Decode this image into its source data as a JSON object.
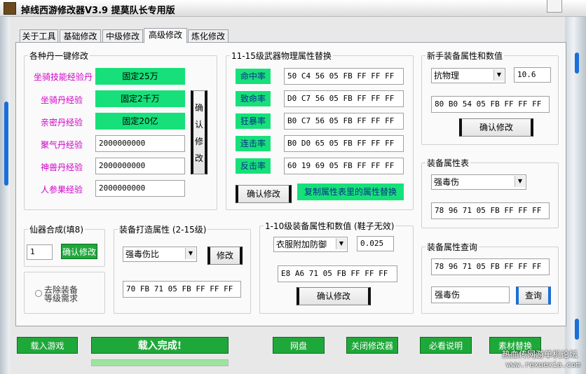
{
  "window": {
    "title": "掉线西游修改器V3.9  提莫队长专用版"
  },
  "tabs": [
    "关于工具",
    "基础修改",
    "中级修改",
    "高级修改",
    "炼化修改"
  ],
  "dan": {
    "title": "各种丹一键修改",
    "rows": [
      {
        "label": "坐骑技能经验丹",
        "value": "固定25万"
      },
      {
        "label": "坐骑丹经验",
        "value": "固定2千万"
      },
      {
        "label": "亲密丹经验",
        "value": "固定20亿"
      },
      {
        "label": "聚气丹经验",
        "value": "2000000000"
      },
      {
        "label": "神兽丹经验",
        "value": "2000000000"
      },
      {
        "label": "人参果经验",
        "value": "2000000000"
      }
    ],
    "confirm": [
      "确",
      "认",
      "修",
      "改"
    ]
  },
  "weapon": {
    "title": "11-15级武器物理属性替换",
    "rows": [
      {
        "label": "命中率",
        "value": "50 C4 56 05 FB FF FF FF"
      },
      {
        "label": "致命率",
        "value": "D0 C7 56 05 FB FF FF FF"
      },
      {
        "label": "狂暴率",
        "value": "B0 C7 56 05 FB FF FF FF"
      },
      {
        "label": "连击率",
        "value": "B0 D0 65 05 FB FF FF FF"
      },
      {
        "label": "反击率",
        "value": "60 19 69 05 FB FF FF FF"
      }
    ],
    "confirm": "确认修改",
    "copy": "复制属性表里的属性替换"
  },
  "newbie": {
    "title": "新手装备属性和数值",
    "attr": "抗物理",
    "num": "10.6",
    "code": "80 B0 54 05 FB FF FF FF",
    "confirm": "确认修改"
  },
  "attrtable": {
    "title": "装备属性表",
    "attr": "强毒伤",
    "code": "78 96 71 05 FB FF FF FF"
  },
  "query": {
    "title": "装备属性查询",
    "code": "78 96 71 05 FB FF FF FF",
    "name": "强毒伤",
    "btn": "查询"
  },
  "synth": {
    "title": "仙器合成(填8)",
    "value": "1",
    "btn": "确认修改",
    "radio": "去除装备等级需求"
  },
  "forge": {
    "title": "装备打造属性 (2-15级)",
    "attr": "强毒伤比",
    "btn": "修改",
    "code": "70 FB 71 05 FB FF FF FF"
  },
  "lvl110": {
    "title": "1-10级装备属性和数值 (鞋子无效)",
    "attr": "衣服附加防御",
    "num": "0.025",
    "code": "E8 A6 71 05 FB FF FF FF",
    "confirm": "确认修改"
  },
  "bottom": {
    "load_game": "载入游戏",
    "status": "载入完成!",
    "netdisk": "网盘",
    "close": "关闭修改器",
    "readme": "必看说明",
    "material": "素材替换",
    "progress": 1.0
  },
  "watermark": {
    "line1": "热血传网游单机论坛",
    "line2": "www.rexuexia.com"
  },
  "colors": {
    "green": "#17e07a",
    "darkgreen": "#1fa83a",
    "magenta": "#d000c8"
  }
}
